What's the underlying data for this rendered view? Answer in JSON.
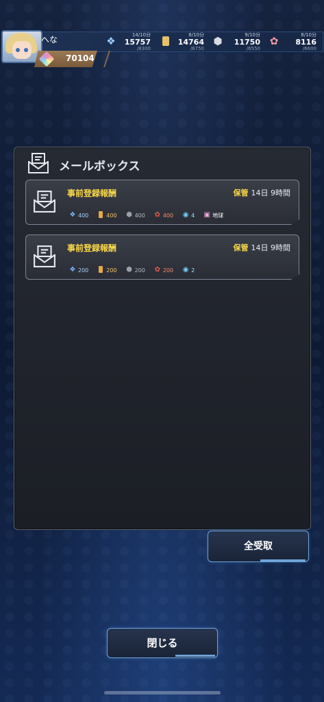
{
  "header": {
    "player_name": "へな",
    "gems": "70104",
    "resources": [
      {
        "icon": "crystal-icon",
        "rate": "14/10分",
        "value": "15757",
        "max": "/8300"
      },
      {
        "icon": "fuel-icon",
        "rate": "8/10分",
        "value": "14764",
        "max": "/6750"
      },
      {
        "icon": "ore-icon",
        "rate": "9/10分",
        "value": "11750",
        "max": "/6550"
      },
      {
        "icon": "core-icon",
        "rate": "8/10分",
        "value": "8116",
        "max": "/6600"
      }
    ]
  },
  "mailbox": {
    "title": "メールボックス",
    "mails": [
      {
        "title": "事前登録報酬",
        "keep_label": "保管",
        "keep_time": "14日 9時間",
        "items": [
          {
            "icon": "crystal-icon",
            "value": "400"
          },
          {
            "icon": "fuel-icon",
            "value": "400"
          },
          {
            "icon": "ore-icon",
            "value": "400"
          },
          {
            "icon": "core-icon",
            "value": "400"
          },
          {
            "icon": "badge-icon",
            "value": "4"
          },
          {
            "icon": "land-icon",
            "value": "地球"
          }
        ]
      },
      {
        "title": "事前登録報酬",
        "keep_label": "保管",
        "keep_time": "14日 9時間",
        "items": [
          {
            "icon": "crystal-icon",
            "value": "200"
          },
          {
            "icon": "fuel-icon",
            "value": "200"
          },
          {
            "icon": "ore-icon",
            "value": "200"
          },
          {
            "icon": "core-icon",
            "value": "200"
          },
          {
            "icon": "badge-icon",
            "value": "2"
          }
        ]
      }
    ],
    "receive_all_label": "全受取"
  },
  "close_label": "閉じる"
}
